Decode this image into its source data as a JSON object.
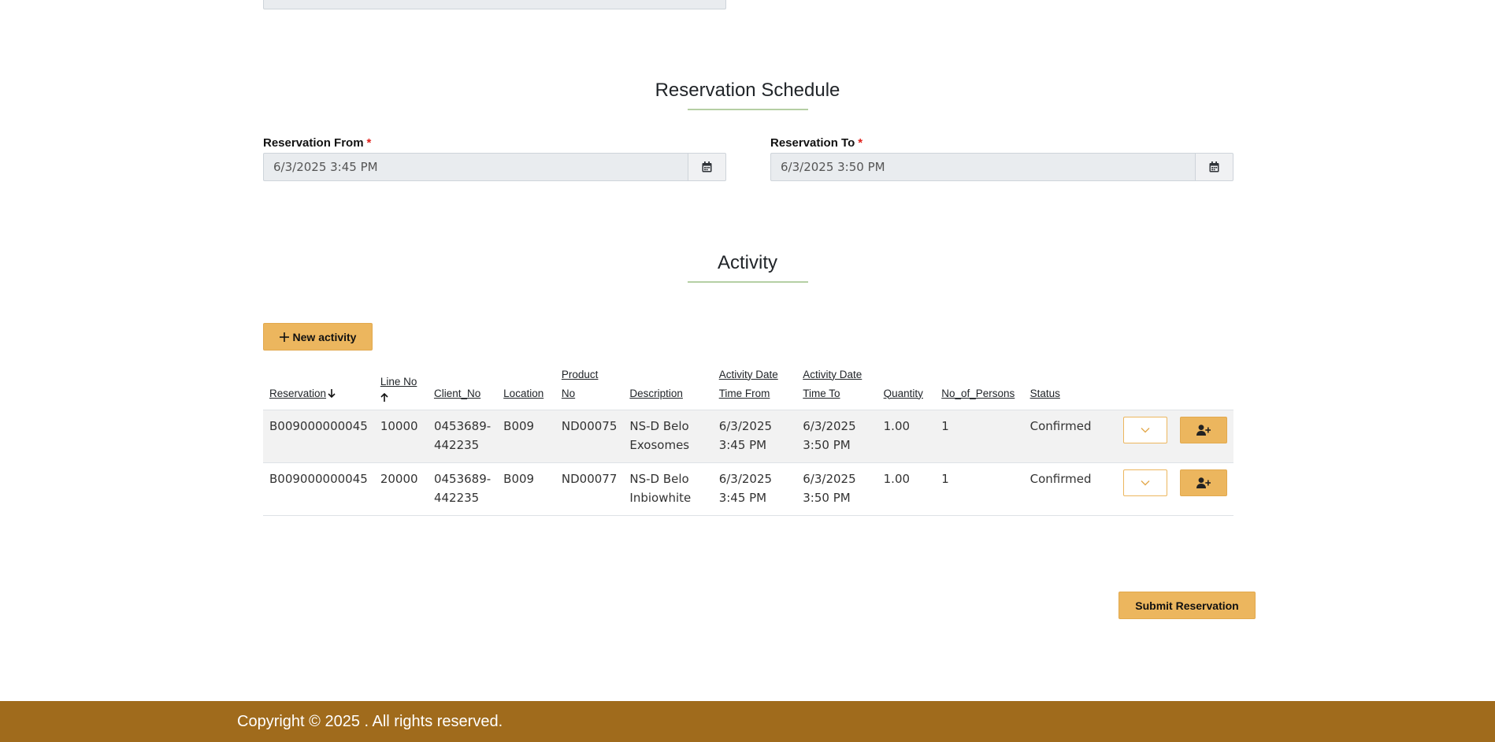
{
  "schedule": {
    "title": "Reservation Schedule",
    "from_label": "Reservation From",
    "to_label": "Reservation To",
    "required_mark": "*",
    "from_value": "6/3/2025 3:45 PM",
    "to_value": "6/3/2025 3:50 PM"
  },
  "activity": {
    "title": "Activity",
    "new_button_label": "New activity",
    "columns": [
      [
        "Reservation"
      ],
      [
        "Line No"
      ],
      [
        "Client_No"
      ],
      [
        "Location"
      ],
      [
        "Product",
        "No"
      ],
      [
        "Description"
      ],
      [
        "Activity Date",
        "Time From"
      ],
      [
        "Activity Date",
        "Time To"
      ],
      [
        "Quantity"
      ],
      [
        "No_of_Persons"
      ],
      [
        "Status"
      ]
    ],
    "rows": [
      {
        "reservation": "B009000000045",
        "line_no": "10000",
        "client_no": [
          "0453689-",
          "442235"
        ],
        "location": "B009",
        "product_no": "ND00075",
        "description": [
          "NS-D Belo",
          "Exosomes"
        ],
        "time_from": [
          "6/3/2025",
          "3:45 PM"
        ],
        "time_to": [
          "6/3/2025",
          "3:50 PM"
        ],
        "quantity": "1.00",
        "persons": "1",
        "status": "Confirmed"
      },
      {
        "reservation": "B009000000045",
        "line_no": "20000",
        "client_no": [
          "0453689-",
          "442235"
        ],
        "location": "B009",
        "product_no": "ND00077",
        "description": [
          "NS-D Belo",
          "Inbiowhite"
        ],
        "time_from": [
          "6/3/2025",
          "3:45 PM"
        ],
        "time_to": [
          "6/3/2025",
          "3:50 PM"
        ],
        "quantity": "1.00",
        "persons": "1",
        "status": "Confirmed"
      }
    ]
  },
  "submit_label": "Submit Reservation",
  "footer": {
    "copyright": "Copyright © 2025 . All rights reserved."
  },
  "icons": [
    "calendar-icon",
    "plus-icon",
    "arrow-down-icon",
    "arrow-up-icon",
    "chevron-down-icon",
    "user-plus-icon"
  ],
  "colors": {
    "accent": "#ecb65e",
    "footer_bg": "#a06b1c",
    "underline": "#b5cfa4",
    "required": "#e0201b"
  }
}
